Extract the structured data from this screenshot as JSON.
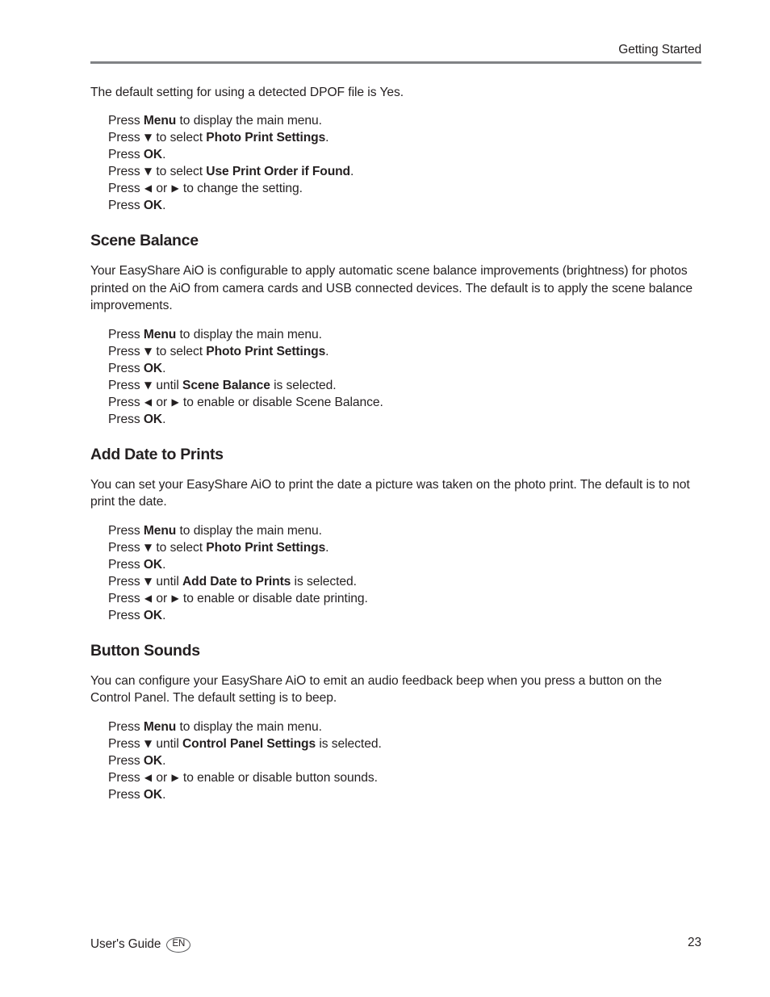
{
  "header": {
    "title": "Getting Started"
  },
  "intro": {
    "text": "The default setting for using a detected DPOF file is Yes."
  },
  "glyphs": {
    "down": "▼",
    "left": "◀",
    "right": "▶"
  },
  "dpof_steps": [
    {
      "pre": "Press ",
      "bold": "Menu",
      "post": " to display the main menu."
    },
    {
      "pre": "Press ",
      "glyph": "▼",
      "mid": " to select ",
      "bold": "Photo Print Settings",
      "post": "."
    },
    {
      "pre": "Press ",
      "bold": "OK",
      "post": "."
    },
    {
      "pre": "Press ",
      "glyph": "▼",
      "mid": " to select ",
      "bold": "Use Print Order if Found",
      "post": "."
    },
    {
      "pre": "Press ",
      "glyph": "◀",
      "mid": " or ",
      "glyph2": "▶",
      "post": " to change the setting."
    },
    {
      "pre": "Press ",
      "bold": "OK",
      "post": "."
    }
  ],
  "sections": [
    {
      "heading": "Scene Balance",
      "paragraph": "Your EasyShare AiO is configurable to apply automatic scene balance improvements (brightness) for photos printed on the AiO from camera cards and USB connected devices. The default is to apply the scene balance improvements.",
      "steps": [
        {
          "pre": "Press ",
          "bold": "Menu",
          "post": " to display the main menu."
        },
        {
          "pre": "Press ",
          "glyph": "▼",
          "mid": " to select ",
          "bold": "Photo Print Settings",
          "post": "."
        },
        {
          "pre": "Press ",
          "bold": "OK",
          "post": "."
        },
        {
          "pre": "Press ",
          "glyph": "▼",
          "mid": " until ",
          "bold": "Scene Balance",
          "post": " is selected."
        },
        {
          "pre": "Press ",
          "glyph": "◀",
          "mid": " or ",
          "glyph2": "▶",
          "post": " to enable or disable Scene Balance."
        },
        {
          "pre": "Press ",
          "bold": "OK",
          "post": "."
        }
      ]
    },
    {
      "heading": "Add Date to Prints",
      "paragraph": "You can set your EasyShare AiO to print the date a picture was taken on the photo print. The default is to not print the date.",
      "steps": [
        {
          "pre": "Press ",
          "bold": "Menu",
          "post": " to display the main menu."
        },
        {
          "pre": "Press ",
          "glyph": "▼",
          "mid": " to select ",
          "bold": "Photo Print Settings",
          "post": "."
        },
        {
          "pre": "Press ",
          "bold": "OK",
          "post": "."
        },
        {
          "pre": "Press ",
          "glyph": "▼",
          "mid": " until ",
          "bold": "Add Date to Prints",
          "post": " is selected."
        },
        {
          "pre": "Press ",
          "glyph": "◀",
          "mid": " or ",
          "glyph2": "▶",
          "post": " to enable or disable date printing."
        },
        {
          "pre": "Press ",
          "bold": "OK",
          "post": "."
        }
      ]
    },
    {
      "heading": "Button Sounds",
      "paragraph": "You can configure your EasyShare AiO to emit an audio feedback beep when you press a button on the Control Panel. The default setting is to beep.",
      "steps": [
        {
          "pre": "Press ",
          "bold": "Menu",
          "post": " to display the main menu."
        },
        {
          "pre": "Press ",
          "glyph": "▼",
          "mid": " until ",
          "bold": "Control Panel Settings",
          "post": " is selected."
        },
        {
          "pre": "Press ",
          "bold": "OK",
          "post": "."
        },
        {
          "pre": "Press ",
          "glyph": "◀",
          "mid": " or ",
          "glyph2": "▶",
          "post": " to enable or disable button sounds."
        },
        {
          "pre": "Press ",
          "bold": "OK",
          "post": "."
        }
      ]
    }
  ],
  "footer": {
    "label": "User's Guide",
    "language_badge": "EN",
    "page_number": "23"
  }
}
